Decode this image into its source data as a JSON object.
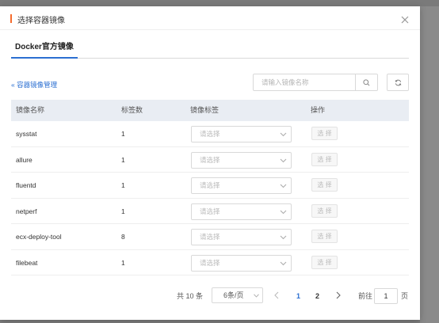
{
  "modal": {
    "title": "选择容器镜像",
    "accent_color": "#f56c2d"
  },
  "tabs": [
    {
      "label": "Docker官方镜像",
      "active": true
    }
  ],
  "back_link": "« 容器镜像管理",
  "search": {
    "placeholder": "请输入镜像名称",
    "value": ""
  },
  "icons": {
    "close": "close-icon",
    "search": "search-icon",
    "refresh": "refresh-icon",
    "dropdown": "chevron-down-icon",
    "prev": "chevron-left-icon",
    "next": "chevron-right-icon"
  },
  "table": {
    "headers": [
      "镜像名称",
      "标签数",
      "镜像标签",
      "操作"
    ],
    "rows": [
      {
        "name": "sysstat",
        "tag_count": "1",
        "tag_placeholder": "请选择",
        "action": "选 择"
      },
      {
        "name": "allure",
        "tag_count": "1",
        "tag_placeholder": "请选择",
        "action": "选 择"
      },
      {
        "name": "fluentd",
        "tag_count": "1",
        "tag_placeholder": "请选择",
        "action": "选 择"
      },
      {
        "name": "netperf",
        "tag_count": "1",
        "tag_placeholder": "请选择",
        "action": "选 择"
      },
      {
        "name": "ecx-deploy-tool",
        "tag_count": "8",
        "tag_placeholder": "请选择",
        "action": "选 择"
      },
      {
        "name": "filebeat",
        "tag_count": "1",
        "tag_placeholder": "请选择",
        "action": "选 择"
      }
    ]
  },
  "pagination": {
    "total": "共 10 条",
    "page_size": "6条/页",
    "pages": [
      "1",
      "2"
    ],
    "current_page": "1",
    "goto_label": "前往",
    "goto_value": "1",
    "goto_unit": "页",
    "active_color": "#2b6fd1"
  }
}
